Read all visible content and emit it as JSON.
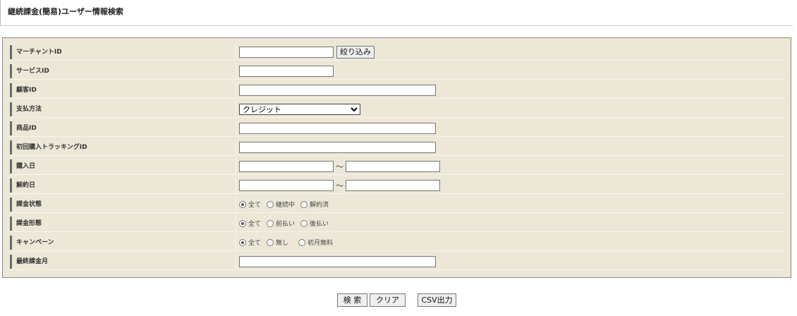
{
  "page": {
    "title": "継続課金(簡易)ユーザー情報検索"
  },
  "form": {
    "merchant_id": {
      "label": "マーチャントID",
      "value": "",
      "button": "絞り込み"
    },
    "service_id": {
      "label": "サービスID",
      "value": ""
    },
    "customer_id": {
      "label": "顧客ID",
      "value": ""
    },
    "payment_method": {
      "label": "支払方法",
      "selected": "クレジット"
    },
    "product_id": {
      "label": "商品ID",
      "value": ""
    },
    "tracking_id": {
      "label": "初回購入トラッキングID",
      "value": ""
    },
    "purchase_date": {
      "label": "購入日",
      "from": "",
      "to": "",
      "separator": "～"
    },
    "cancel_date": {
      "label": "解約日",
      "from": "",
      "to": "",
      "separator": "～"
    },
    "billing_status": {
      "label": "課金状態",
      "options": [
        "全て",
        "継続中",
        "解約済"
      ],
      "selected": "全て"
    },
    "billing_type": {
      "label": "課金形態",
      "options": [
        "全て",
        "前払い",
        "後払い"
      ],
      "selected": "全て"
    },
    "campaign": {
      "label": "キャンペーン",
      "options": [
        "全て",
        "無し",
        "初月無料"
      ],
      "selected": "全て"
    },
    "last_billing_month": {
      "label": "最終課金月",
      "value": ""
    }
  },
  "actions": {
    "search": "検 索",
    "clear": "クリア",
    "csv": "CSV出力"
  }
}
